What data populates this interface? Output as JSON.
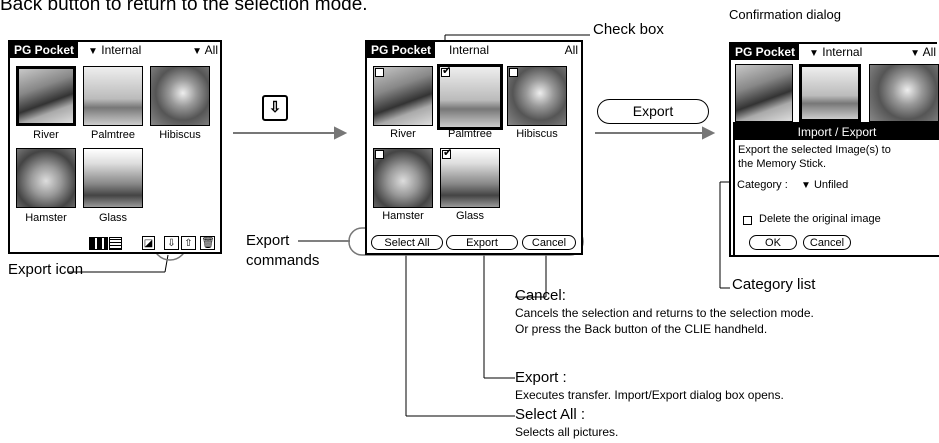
{
  "header_text": "Back button to return to the selection mode.",
  "confirmation_dialog_caption": "Confirmation dialog",
  "check_box_label": "Check box",
  "export_icon_label": "Export icon",
  "export_commands_label": [
    "Export",
    "commands"
  ],
  "category_list_label": "Category list",
  "big_export_button": "Export",
  "app": {
    "name": "PG Pocket",
    "location": "Internal",
    "category": "All"
  },
  "pictures": [
    "River",
    "Palmtree",
    "Hibiscus",
    "Hamster",
    "Glass"
  ],
  "checked_states": [
    false,
    true,
    false,
    false,
    true
  ],
  "export_commands": [
    "Select All",
    "Export",
    "Cancel"
  ],
  "dialog": {
    "title": "Import / Export",
    "message_line1": "Export the selected Image(s) to",
    "message_line2": "the Memory Stick.",
    "category_label": "Category :",
    "category_value": "Unfiled",
    "delete_option": "Delete the original image",
    "ok": "OK",
    "cancel": "Cancel"
  },
  "explanations": {
    "cancel_title": "Cancel:",
    "cancel_line1": "Cancels the selection and returns to the selection mode.",
    "cancel_line2": "Or press the Back button of the CLIE handheld.",
    "export_title": "Export :",
    "export_line1": "Executes transfer. Import/Export dialog box opens.",
    "select_all_title": "Select All :",
    "select_all_line1": "Selects all pictures."
  }
}
